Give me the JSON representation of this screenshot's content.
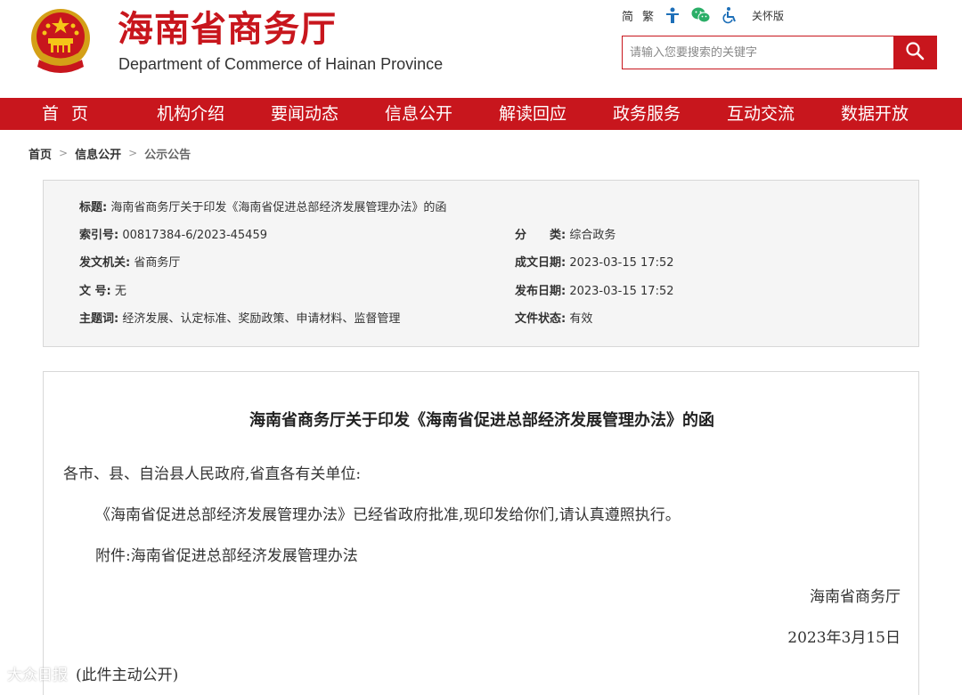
{
  "header": {
    "site_title": "海南省商务厅",
    "site_subtitle": "Department of Commerce of Hainan Province",
    "toplinks": {
      "simplified": "简",
      "traditional": "繁",
      "care": "关怀版"
    },
    "search": {
      "placeholder": "请输入您要搜索的关键字"
    }
  },
  "nav": {
    "items": [
      "首页",
      "机构介绍",
      "要闻动态",
      "信息公开",
      "解读回应",
      "政务服务",
      "互动交流",
      "数据开放"
    ]
  },
  "breadcrumb": {
    "items": [
      "首页",
      "信息公开",
      "公示公告"
    ],
    "separator": ">"
  },
  "meta": {
    "title_label": "标题:",
    "title_value": "海南省商务厅关于印发《海南省促进总部经济发展管理办法》的函",
    "index_label": "索引号:",
    "index_value": "00817384-6/2023-45459",
    "category_label": "分　　类:",
    "category_value": "综合政务",
    "issuer_label": "发文机关:",
    "issuer_value": "省商务厅",
    "date_made_label": "成文日期:",
    "date_made_value": "2023-03-15 17:52",
    "doc_no_label": "文 号:",
    "doc_no_value": "无",
    "date_pub_label": "发布日期:",
    "date_pub_value": "2023-03-15 17:52",
    "keywords_label": "主题词:",
    "keywords_value": "经济发展、认定标准、奖励政策、申请材料、监督管理",
    "status_label": "文件状态:",
    "status_value": "有效"
  },
  "document": {
    "title": "海南省商务厅关于印发《海南省促进总部经济发展管理办法》的函",
    "salutation": "各市、县、自治县人民政府,省直各有关单位:",
    "body": "《海南省促进总部经济发展管理办法》已经省政府批准,现印发给你们,请认真遵照执行。",
    "attachment": "附件:海南省促进总部经济发展管理办法",
    "signature": "海南省商务厅",
    "date": "2023年3月15日",
    "disclosure": "(此件主动公开)"
  },
  "watermark": "大众日报",
  "colors": {
    "brand_red": "#c8161d",
    "meta_bg": "#f5f5f5"
  }
}
